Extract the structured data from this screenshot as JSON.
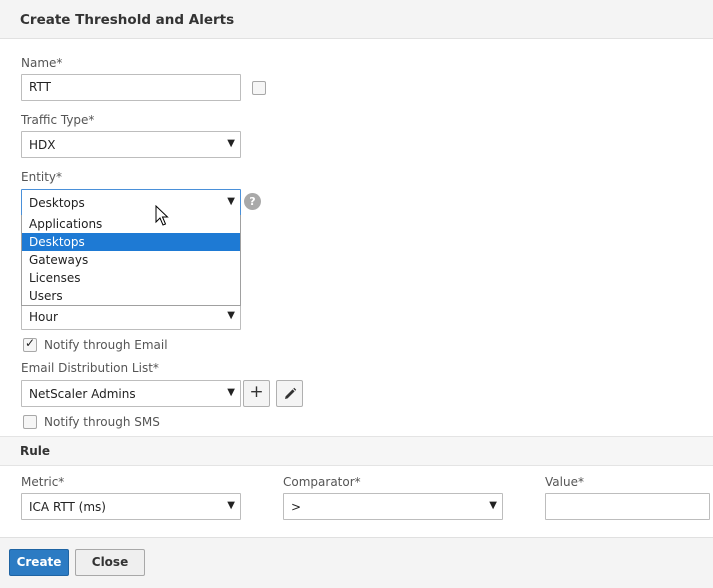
{
  "dialog": {
    "title": "Create Threshold and Alerts"
  },
  "form": {
    "name_label": "Name*",
    "name_value": "RTT",
    "traffic_type_label": "Traffic Type*",
    "traffic_type_value": "HDX",
    "entity_label": "Entity*",
    "entity_value": "Desktops",
    "entity_options": [
      "Applications",
      "Desktops",
      "Gateways",
      "Licenses",
      "Users"
    ],
    "entity_selected_option": "Desktops",
    "period_value": "Hour",
    "notify_email_label": "Notify through Email",
    "notify_email_checked": true,
    "email_list_label": "Email Distribution List*",
    "email_list_value": "NetScaler Admins",
    "notify_sms_label": "Notify through SMS",
    "notify_sms_checked": false
  },
  "rule": {
    "section_title": "Rule",
    "metric_label": "Metric*",
    "metric_value": "ICA RTT (ms)",
    "comparator_label": "Comparator*",
    "comparator_value": ">",
    "value_label": "Value*",
    "value_value": ""
  },
  "footer": {
    "create_label": "Create",
    "close_label": "Close"
  },
  "icons": {
    "dropdown_arrow": "▼",
    "help": "?",
    "check": "✓",
    "add": "+",
    "edit": "pencil-icon"
  },
  "colors": {
    "primary": "#2c7bc3",
    "selection": "#1e7ad4",
    "header_bg": "#f4f4f4"
  }
}
